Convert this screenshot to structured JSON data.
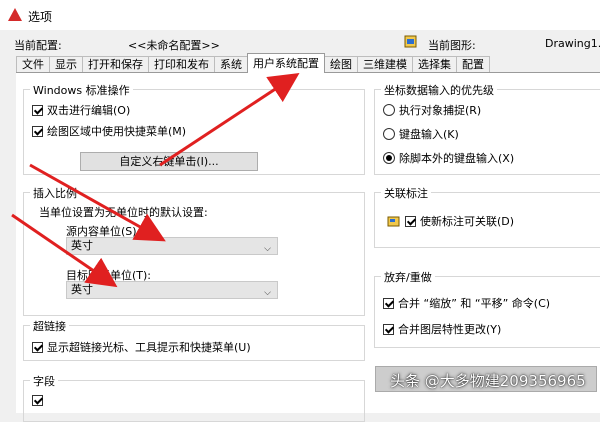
{
  "window": {
    "title": "选项"
  },
  "header": {
    "current_config_label": "当前配置:",
    "current_config_value": "<<未命名配置>>",
    "current_drawing_label": "当前图形:",
    "current_drawing_value": "Drawing1."
  },
  "tabs": [
    {
      "label": "文件"
    },
    {
      "label": "显示"
    },
    {
      "label": "打开和保存"
    },
    {
      "label": "打印和发布"
    },
    {
      "label": "系统"
    },
    {
      "label": "用户系统配置",
      "active": true
    },
    {
      "label": "绘图"
    },
    {
      "label": "三维建模"
    },
    {
      "label": "选择集"
    },
    {
      "label": "配置"
    }
  ],
  "windows_ops": {
    "title": "Windows 标准操作",
    "double_click_edit": {
      "label": "双击进行编辑(O)",
      "checked": true
    },
    "shortcut_menu": {
      "label": "绘图区域中使用快捷菜单(M)",
      "checked": true
    },
    "customize_button": "自定义右键单击(I)..."
  },
  "insert_scale": {
    "title": "插入比例",
    "desc": "当单位设置为无单位时的默认设置:",
    "source_label": "源内容单位(S)",
    "source_value": "英寸",
    "target_label": "目标图形单位(T):",
    "target_value": "英寸"
  },
  "hyperlink": {
    "title": "超链接",
    "show_option": {
      "label": "显示超链接光标、工具提示和快捷菜单(U)",
      "checked": true
    }
  },
  "fields": {
    "title": "字段"
  },
  "coord_priority": {
    "title": "坐标数据输入的优先级",
    "options": [
      {
        "label": "执行对象捕捉(R)",
        "selected": false
      },
      {
        "label": "键盘输入(K)",
        "selected": false
      },
      {
        "label": "除脚本外的键盘输入(X)",
        "selected": true
      }
    ]
  },
  "assoc_dim": {
    "title": "关联标注",
    "option": {
      "label": "使新标注可关联(D)",
      "checked": true
    }
  },
  "undo_redo": {
    "title": "放弃/重做",
    "merge_zoom": {
      "label": "合并 “缩放” 和 “平移” 命令(C)",
      "checked": true
    },
    "merge_layer": {
      "label": "合并图层特性更改(Y)",
      "checked": true
    }
  },
  "watermark": "头条 @大多物建209356965",
  "colors": {
    "arrow": "#e02020",
    "accent": "#d42a2a"
  }
}
